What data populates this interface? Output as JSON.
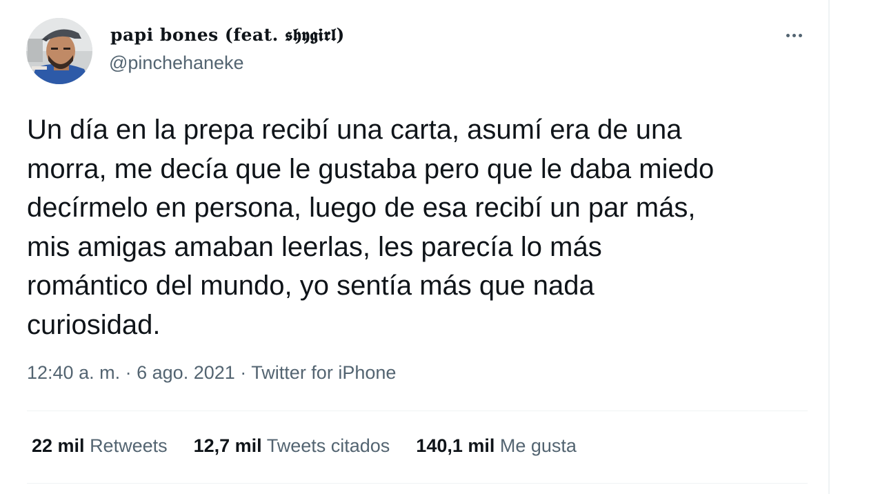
{
  "tweet": {
    "author": {
      "display_name": "papi bones (feat. 𝖘𝖍𝖞𝖌𝖎𝖗𝖑)",
      "handle": "@pinchehaneke"
    },
    "more_icon": "ellipsis-icon",
    "text": "Un día en la prepa recibí una carta, asumí era de una\nmorra, me decía que le gustaba pero que le daba miedo\ndecírmelo en persona, luego de esa recibí un par más,\nmis amigas amaban leerlas, les parecía lo más\nromántico del mundo, yo sentía más que nada\ncuriosidad.",
    "time": "12:40 a. m.",
    "separator": "·",
    "date": "6 ago. 2021",
    "source": "Twitter for iPhone",
    "stats": {
      "retweets": {
        "count": "22 mil",
        "label": "Retweets"
      },
      "quotes": {
        "count": "12,7 mil",
        "label": "Tweets citados"
      },
      "likes": {
        "count": "140,1 mil",
        "label": "Me gusta"
      }
    }
  },
  "colors": {
    "text_primary": "#0f1419",
    "text_secondary": "#536471",
    "divider": "#eff3f4"
  }
}
